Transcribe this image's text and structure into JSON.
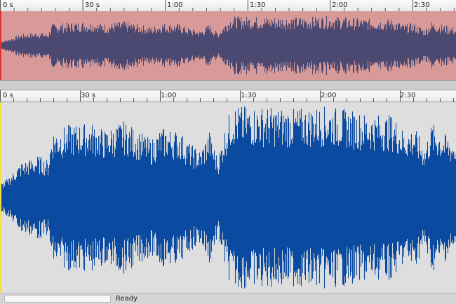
{
  "timeline": {
    "labels": [
      "0 s",
      "30 s",
      "1:00",
      "1:30",
      "2:00",
      "2:30"
    ]
  },
  "overview": {
    "background_color": "#d89a98",
    "wave_color": "#4b4872",
    "cursor_color": "#e03030"
  },
  "main": {
    "background_color": "#dedede",
    "wave_color": "#0a4aa0",
    "cursor_color": "#f4e040"
  },
  "status": {
    "text": "Ready",
    "progress": 0
  }
}
